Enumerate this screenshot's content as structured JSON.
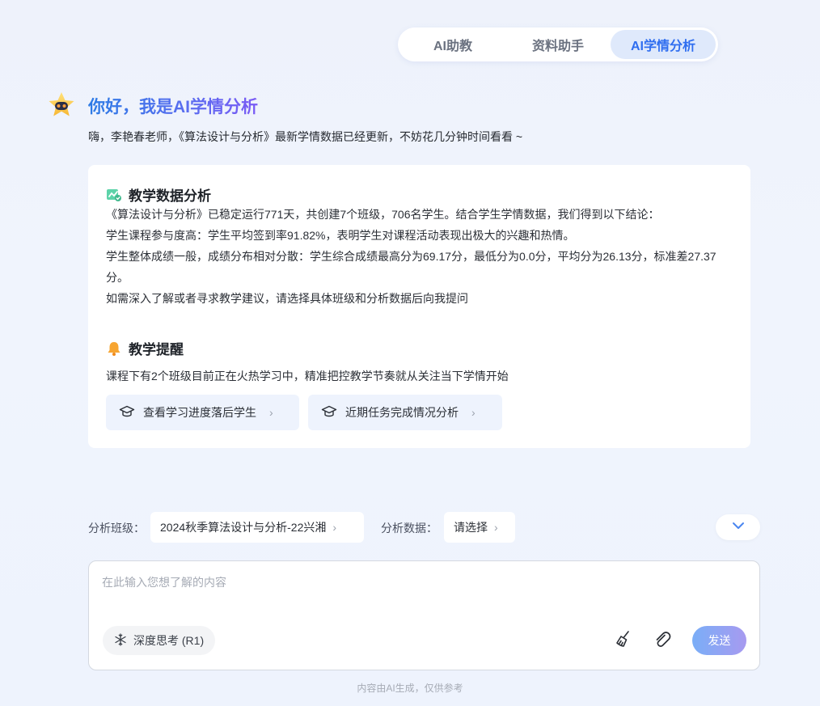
{
  "tabs": [
    {
      "label": "AI助教",
      "active": false
    },
    {
      "label": "资料助手",
      "active": false
    },
    {
      "label": "AI学情分析",
      "active": true
    }
  ],
  "greeting": {
    "title": "你好，我是AI学情分析",
    "subtitle": "嗨，李艳春老师，《算法设计与分析》最新学情数据已经更新，不妨花几分钟时间看看 ~"
  },
  "analysis": {
    "heading": "教学数据分析",
    "lines": [
      "《算法设计与分析》已稳定运行771天，共创建7个班级，706名学生。结合学生学情数据，我们得到以下结论：",
      "学生课程参与度高：学生平均签到率91.82%，表明学生对课程活动表现出极大的兴趣和热情。",
      "学生整体成绩一般，成绩分布相对分散：学生综合成绩最高分为69.17分，最低分为0.0分，平均分为26.13分，标准差27.37分。",
      "如需深入了解或者寻求教学建议，请选择具体班级和分析数据后向我提问"
    ]
  },
  "reminder": {
    "heading": "教学提醒",
    "text": "课程下有2个班级目前正在火热学习中，精准把控教学节奏就从关注当下学情开始",
    "chips": [
      "查看学习进度落后学生",
      "近期任务完成情况分析"
    ]
  },
  "selectors": {
    "class_label": "分析班级：",
    "class_value": "2024秋季算法设计与分析-22兴湘",
    "data_label": "分析数据：",
    "data_value": "请选择"
  },
  "input": {
    "placeholder": "在此输入您想了解的内容",
    "think_label": "深度思考 (R1)",
    "send_label": "发送"
  },
  "footer": "内容由AI生成，仅供参考",
  "colors": {
    "accent": "#2f6ef0",
    "tab_active_bg": "#dfe9fb",
    "chip_bg": "#eef3fd"
  }
}
